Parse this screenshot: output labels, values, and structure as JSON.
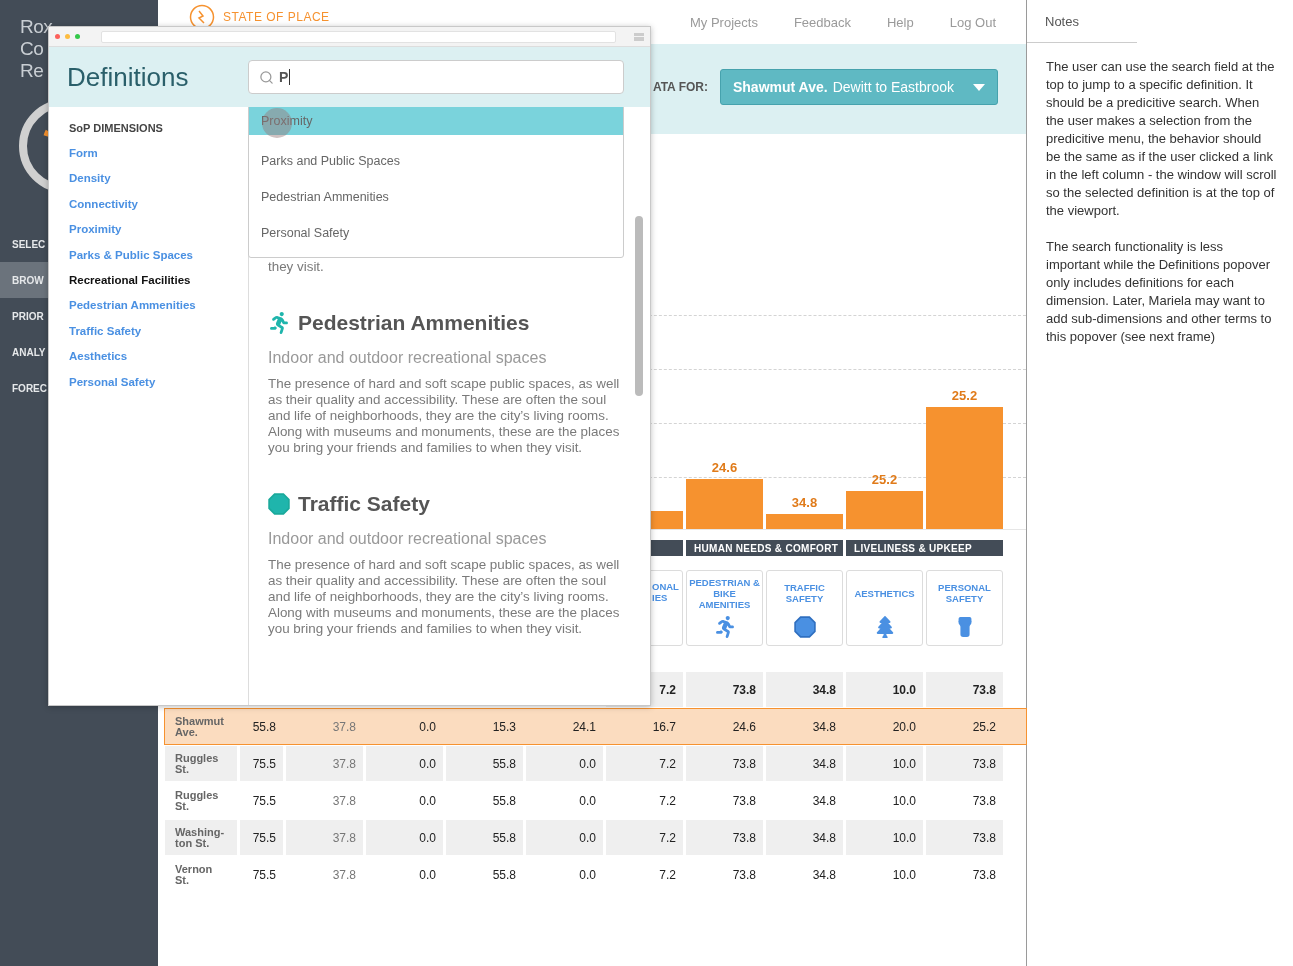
{
  "app_sidebar": {
    "title_lines": [
      "Rox",
      "Co",
      "Re"
    ],
    "nav": [
      {
        "label": "SELEC",
        "selected": false
      },
      {
        "label": "BROW",
        "selected": true
      },
      {
        "label": "PRIOR",
        "selected": false
      },
      {
        "label": "ANALY",
        "selected": false
      },
      {
        "label": "FOREC",
        "selected": false
      }
    ]
  },
  "header": {
    "logo": "STATE OF PLACE",
    "links": [
      "My Projects",
      "Feedback",
      "Help",
      "Log Out"
    ]
  },
  "filter": {
    "label": "ATA FOR:",
    "street": "Shawmut Ave.",
    "segment": "Dewitt to Eastbrook"
  },
  "dimension_groups": [
    {
      "cards": [
        {
          "kind": "partial",
          "label": "ONAL\nIES",
          "bar": {
            "level": 0.072
          }
        }
      ]
    },
    {
      "label": "HUMAN NEEDS & COMFORT",
      "cards": [
        {
          "kind": "full",
          "label": "PEDESTRIAN & BIKE AMENITIES",
          "bar": {
            "value_label": "24.6",
            "level": 0.2
          }
        },
        {
          "kind": "full",
          "label": "TRAFFIC SAFETY",
          "bar": {
            "value_label": "34.8",
            "level": 0.06
          }
        }
      ]
    },
    {
      "label": "LIVELINESS & UPKEEP",
      "cards": [
        {
          "kind": "full",
          "label": "AESTHETICS",
          "bar": {
            "value_label": "25.2",
            "level": 0.152
          }
        },
        {
          "kind": "full",
          "label": "PERSONAL SAFETY",
          "bar": {
            "value_label": "25.2",
            "level": 0.492
          }
        }
      ]
    }
  ],
  "table": {
    "rows": [
      {
        "kind": "summary",
        "selected": false,
        "cells": [
          "",
          "",
          "",
          "",
          "",
          "7.2",
          "73.8",
          "34.8",
          "10.0",
          "73.8"
        ]
      },
      {
        "kind": "street",
        "name": "Shawmut Ave.",
        "selected": true,
        "cells": [
          "55.8",
          "37.8",
          "0.0",
          "15.3",
          "24.1",
          "16.7",
          "24.6",
          "34.8",
          "20.0",
          "25.2"
        ]
      },
      {
        "kind": "street",
        "name": "Ruggles St.",
        "selected": false,
        "cells": [
          "75.5",
          "37.8",
          "0.0",
          "55.8",
          "0.0",
          "7.2",
          "73.8",
          "34.8",
          "10.0",
          "73.8"
        ]
      },
      {
        "kind": "street",
        "name": "Ruggles St.",
        "selected": false,
        "cells": [
          "75.5",
          "37.8",
          "0.0",
          "55.8",
          "0.0",
          "7.2",
          "73.8",
          "34.8",
          "10.0",
          "73.8"
        ]
      },
      {
        "kind": "street",
        "name": "Washing-ton St.",
        "selected": false,
        "cells": [
          "75.5",
          "37.8",
          "0.0",
          "55.8",
          "0.0",
          "7.2",
          "73.8",
          "34.8",
          "10.0",
          "73.8"
        ]
      },
      {
        "kind": "street",
        "name": "Vernon St.",
        "selected": false,
        "cells": [
          "75.5",
          "37.8",
          "0.0",
          "55.8",
          "0.0",
          "7.2",
          "73.8",
          "34.8",
          "10.0",
          "73.8"
        ]
      }
    ]
  },
  "notes": {
    "title": "Notes",
    "paragraphs": [
      "The user can use the search field at the top to jump to a specific definition. It should be a predicitive search. When the user makes a selection from the predicitive menu, the behavior should be the same as if the user clicked a link in the left column - the window will scroll so the selected definition is at the top of the viewport.",
      "The search functionality is less important while the Definitions popover only includes definitions for each dimension. Later, Mariela may want to add sub-dimensions and other terms to this popover (see next frame)"
    ]
  },
  "definitions_popover": {
    "title": "Definitions",
    "search": {
      "value": "P"
    },
    "suggestions": [
      {
        "label": "Proximity",
        "selected": true
      },
      {
        "label": "Parks and Public Spaces",
        "selected": false
      },
      {
        "label": "Pedestrian Ammenities",
        "selected": false
      },
      {
        "label": "Personal Safety",
        "selected": false
      }
    ],
    "nav": {
      "heading": "SoP DIMENSIONS",
      "items": [
        {
          "label": "Form",
          "selected": false
        },
        {
          "label": "Density",
          "selected": false
        },
        {
          "label": "Connectivity",
          "selected": false
        },
        {
          "label": "Proximity",
          "selected": false
        },
        {
          "label": "Parks & Public Spaces",
          "selected": false
        },
        {
          "label": "Recreational Facilities",
          "selected": true
        },
        {
          "label": "Pedestrian Ammenities",
          "selected": false
        },
        {
          "label": "Traffic Safety",
          "selected": false
        },
        {
          "label": "Aesthetics",
          "selected": false
        },
        {
          "label": "Personal Safety",
          "selected": false
        }
      ]
    },
    "sections": [
      {
        "body": "they visit."
      },
      {
        "title": "Pedestrian Ammenities",
        "subtitle": "Indoor and outdoor recreational spaces",
        "body": "The presence of hard and soft scape public spaces, as well as their quality and accessibility. These are often the soul and life of neighborhoods, they are the city’s living rooms. Along with museums and monuments, these are the places you bring your friends and families to when they visit."
      },
      {
        "title": "Traffic Safety",
        "subtitle": "Indoor and outdoor recreational spaces",
        "body": "The presence of hard and soft scape public spaces, as well as their quality and accessibility. These are often the soul and life of neighborhoods, they are the city’s living rooms. Along with museums and monuments, these are the places you bring your friends and families to when they visit."
      }
    ]
  }
}
